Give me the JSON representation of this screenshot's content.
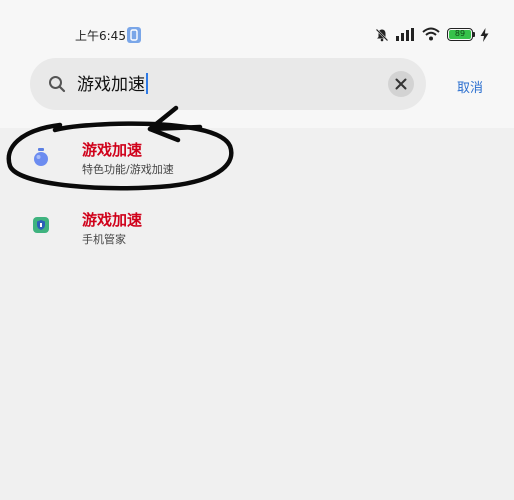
{
  "status_bar": {
    "time": "上午6:45",
    "battery": "89",
    "icons": [
      "app-notification-icon",
      "bell-muted-icon",
      "signal-icon",
      "wifi-icon",
      "battery-icon",
      "charging-bolt-icon"
    ]
  },
  "search": {
    "query": "游戏加速",
    "cancel_label": "取消",
    "icons": [
      "search-icon",
      "clear-icon"
    ]
  },
  "results": [
    {
      "title": "游戏加速",
      "subtitle": "特色功能/游戏加速",
      "icon": "rocket-icon"
    },
    {
      "title": "游戏加速",
      "subtitle": "手机管家",
      "icon": "phone-manager-icon"
    }
  ],
  "colors": {
    "accent": "#2b6fcf",
    "highlight": "#d0021b",
    "battery": "#36c24a"
  }
}
